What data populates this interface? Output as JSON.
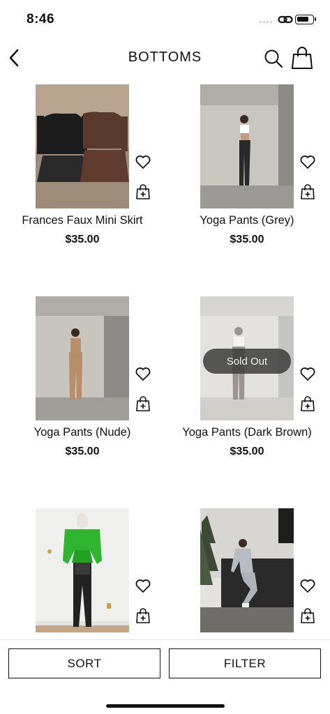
{
  "status_bar": {
    "time": "8:46"
  },
  "header": {
    "title": "BOTTOMS"
  },
  "products": [
    {
      "name": "Frances Faux Mini Skirt",
      "price": "$35.00",
      "sold_out": false
    },
    {
      "name": "Yoga Pants (Grey)",
      "price": "$35.00",
      "sold_out": false
    },
    {
      "name": "Yoga Pants (Nude)",
      "price": "$35.00",
      "sold_out": false
    },
    {
      "name": "Yoga Pants (Dark Brown)",
      "price": "$35.00",
      "sold_out": true,
      "badge": "Sold Out"
    },
    {
      "name": "",
      "price": "",
      "sold_out": false
    },
    {
      "name": "",
      "price": "",
      "sold_out": false
    }
  ],
  "bottom_bar": {
    "sort_label": "SORT",
    "filter_label": "FILTER"
  },
  "colors": {
    "accent": "#111111",
    "background": "#ffffff",
    "sold_out_badge": "#3c3c3c",
    "jacket_green": "#2fb52f"
  },
  "icons": [
    "chevron-left-icon",
    "search-icon",
    "shopping-bag-icon",
    "heart-icon",
    "add-to-bag-icon",
    "link-icon",
    "battery-icon"
  ]
}
